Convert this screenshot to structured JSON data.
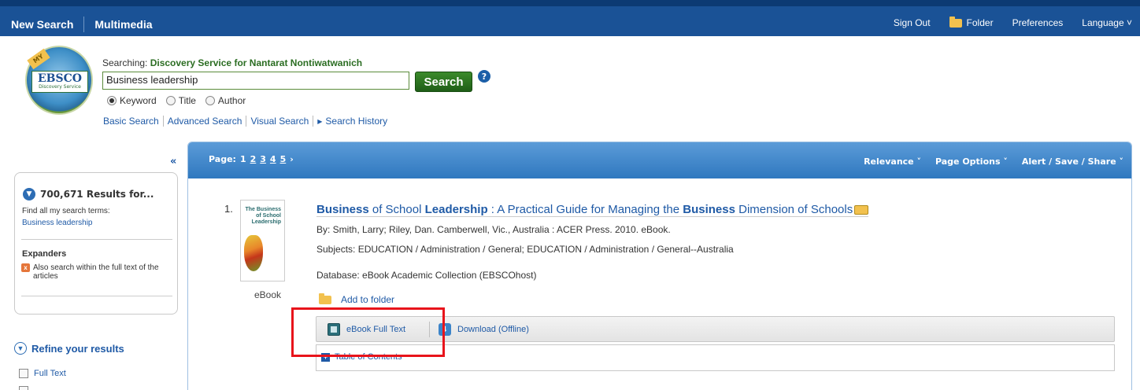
{
  "topbar": {
    "new_search": "New Search",
    "multimedia": "Multimedia",
    "sign_out": "Sign Out",
    "folder": "Folder",
    "preferences": "Preferences",
    "language": "Language ˅"
  },
  "logo": {
    "text": "EBSCO",
    "sub": "Discovery Service",
    "badge": "MY"
  },
  "search": {
    "searching_prefix": "Searching: ",
    "searching_target": "Discovery Service for Nantarat Nontiwatwanich",
    "query": "Business leadership",
    "button": "Search",
    "help": "?",
    "options": [
      "Keyword",
      "Title",
      "Author"
    ],
    "selected": "Keyword",
    "links": [
      "Basic Search",
      "Advanced Search",
      "Visual Search",
      "Search History"
    ]
  },
  "sidebar": {
    "collapse": "«",
    "results_count": "700,671 Results for...",
    "find_all": "Find all my search terms:",
    "term": "Business leadership",
    "expanders_title": "Expanders",
    "expander_item": "Also search within the full text of the articles",
    "refine": "Refine your results",
    "full_text": "Full Text"
  },
  "panel": {
    "page_label": "Page:",
    "pages": [
      "1",
      "2",
      "3",
      "4",
      "5"
    ],
    "next": "›",
    "relevance": "Relevance ˅",
    "page_options": "Page Options ˅",
    "alert_save": "Alert / Save / Share ˅"
  },
  "result": {
    "number": "1.",
    "cover_title": "The Business of School Leadership",
    "type": "eBook",
    "title_parts": [
      {
        "text": "Business",
        "bold": true
      },
      {
        "text": " of School ",
        "bold": false
      },
      {
        "text": "Leadership",
        "bold": true
      },
      {
        "text": " : A Practical Guide for Managing the ",
        "bold": false
      },
      {
        "text": "Business",
        "bold": true
      },
      {
        "text": " Dimension of Schools",
        "bold": false
      }
    ],
    "byline": "By: Smith, Larry; Riley, Dan. Camberwell, Vic., Australia : ACER Press. 2010. eBook.",
    "subjects": "Subjects: EDUCATION / Administration / General; EDUCATION / Administration / General--Australia",
    "database": "Database: eBook Academic Collection (EBSCOhost)",
    "add_to_folder": "Add to folder",
    "ebook_full_text": "eBook Full Text",
    "download": "Download (Offline)",
    "toc": "Table of Contents"
  },
  "colors": {
    "topbar": "#1a5296",
    "link": "#1f5aa6",
    "highlight": "#e8141b"
  }
}
